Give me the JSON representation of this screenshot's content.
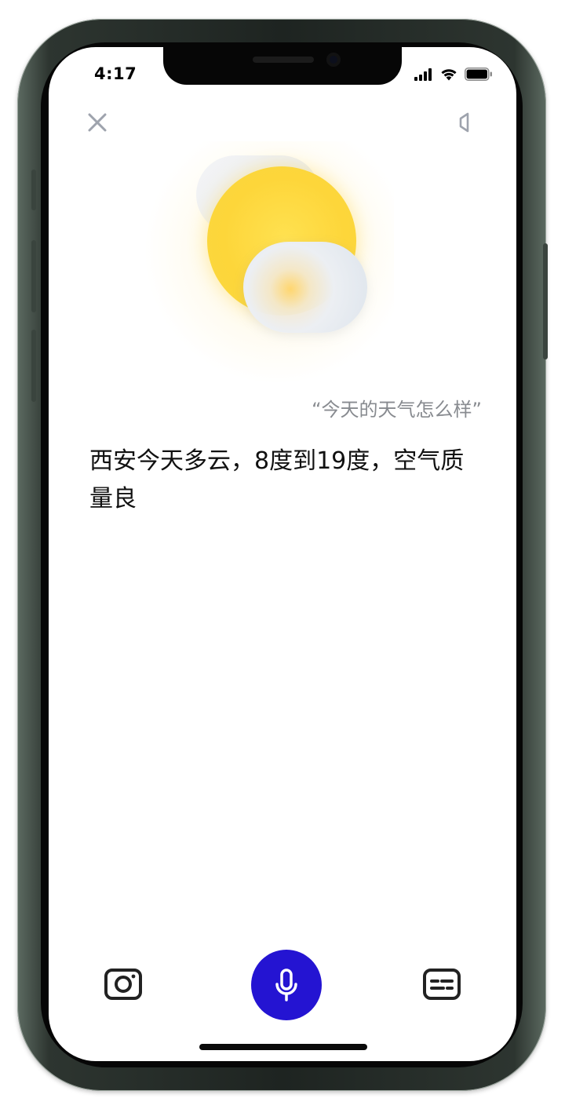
{
  "status_bar": {
    "time": "4:17",
    "icons": [
      "cellular-signal-icon",
      "wifi-icon",
      "battery-icon"
    ]
  },
  "top_bar": {
    "close_icon": "close-icon",
    "volume_icon": "speaker-icon"
  },
  "weather_graphic": {
    "condition_icon": "partly-cloudy-icon",
    "colors": {
      "sun": "#fdd63a",
      "cloud": "#e8ecf1"
    }
  },
  "conversation": {
    "query": "“今天的天气怎么样”",
    "answer": "西安今天多云，8度到19度，空气质量良"
  },
  "bottom_bar": {
    "left_icon": "camera-icon",
    "center_icon": "microphone-icon",
    "right_icon": "keyboard-icon",
    "mic_color": "#2414d2"
  }
}
